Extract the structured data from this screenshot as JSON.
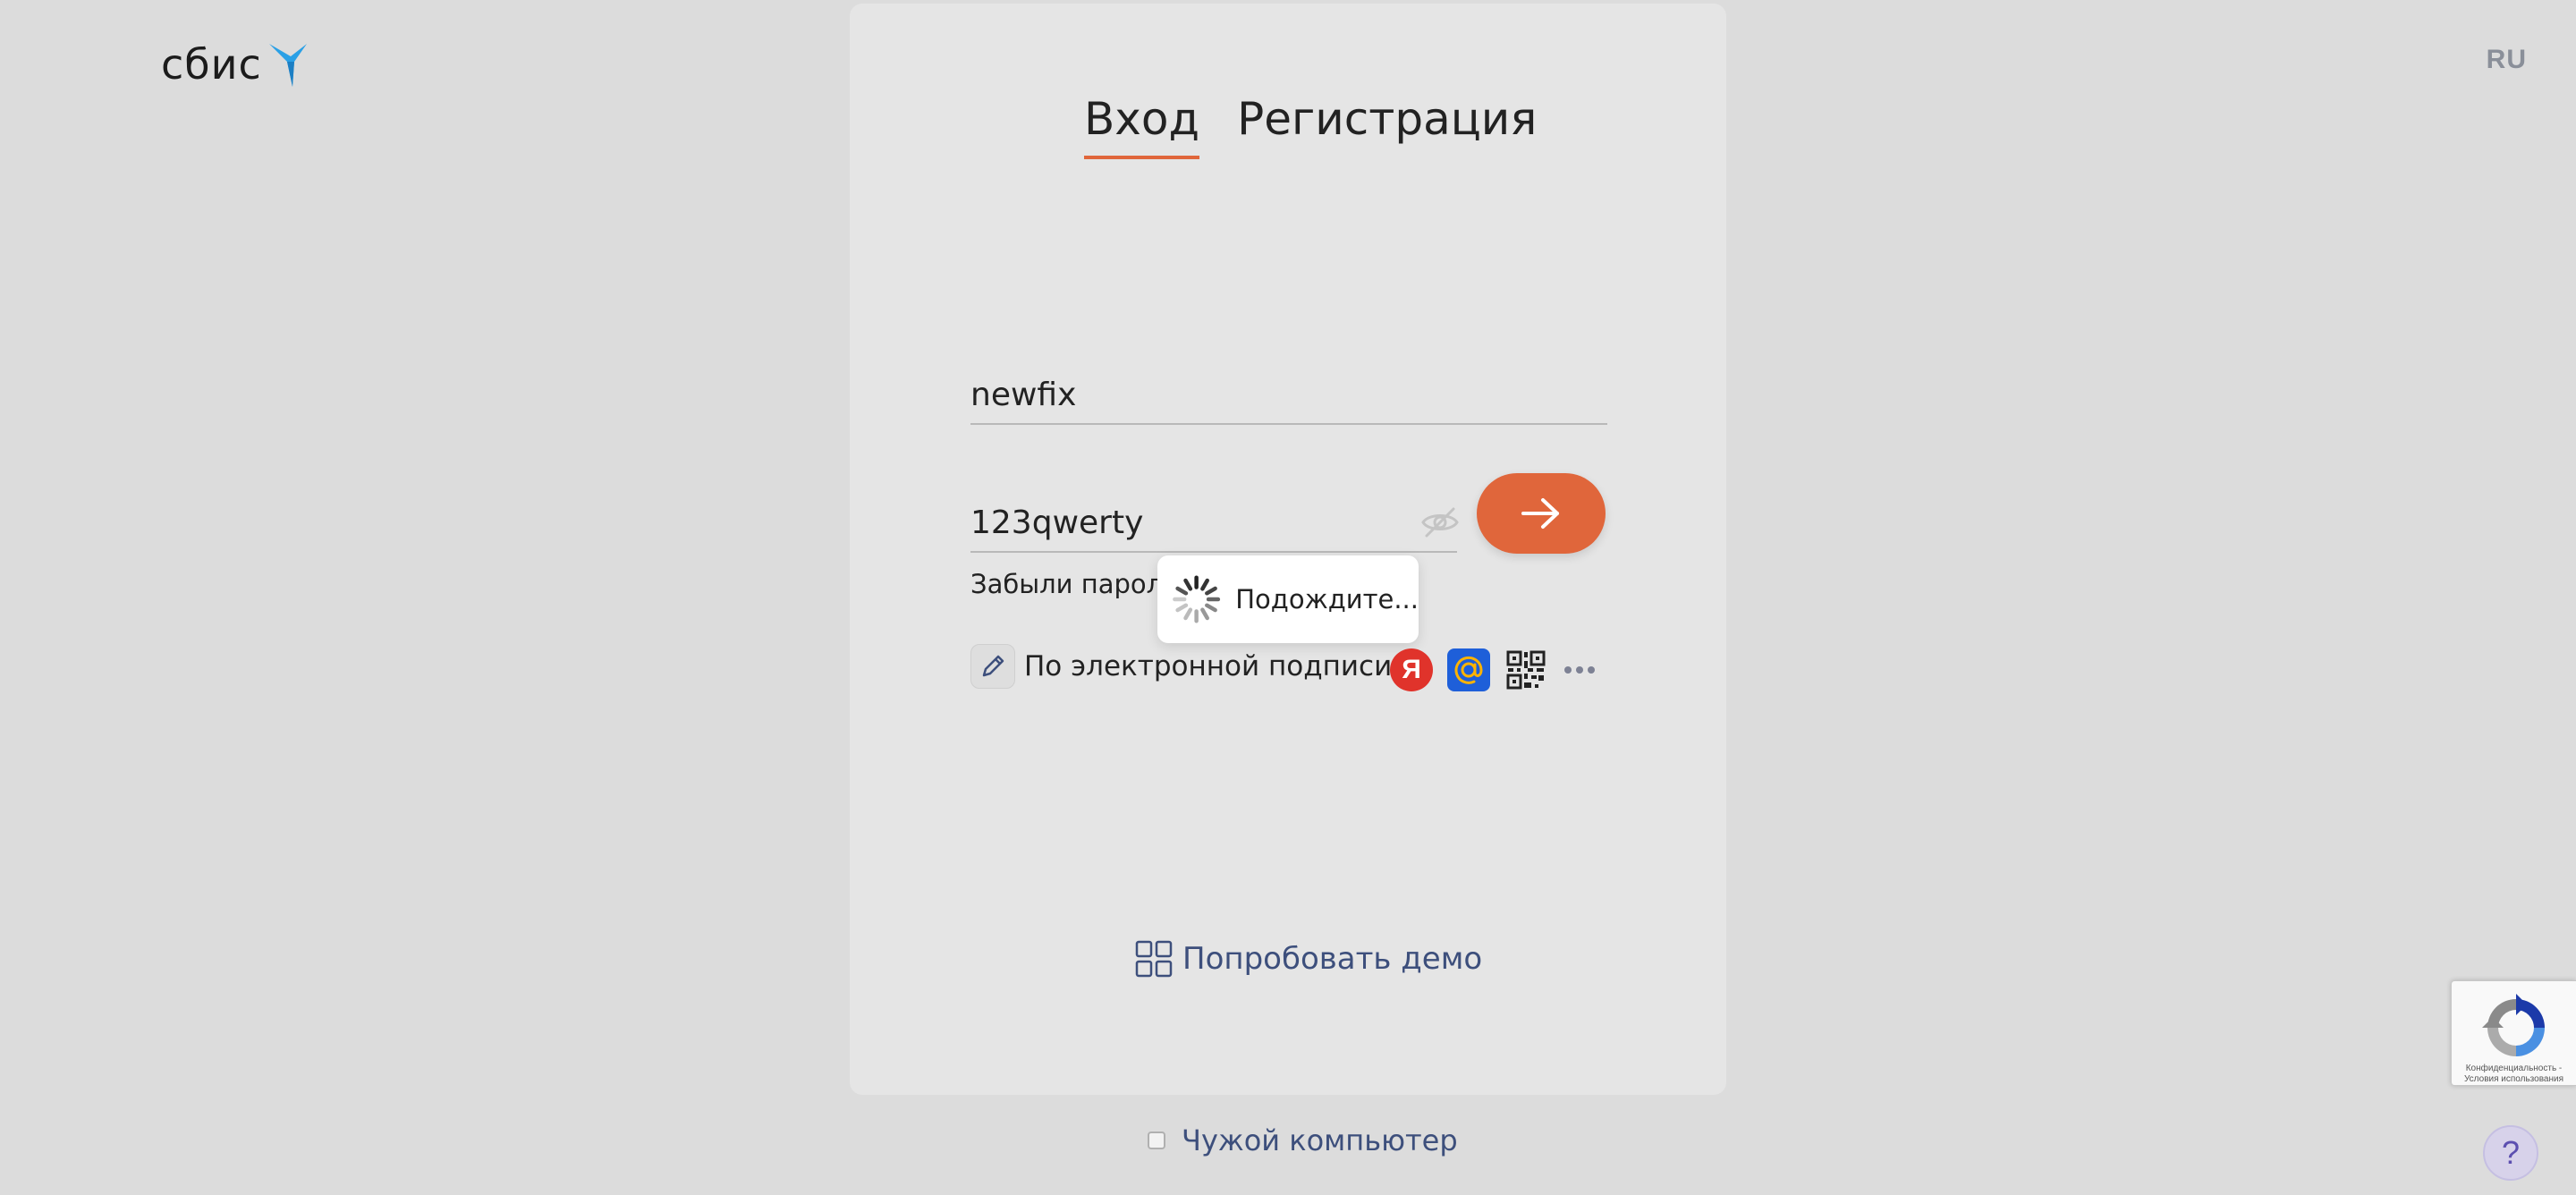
{
  "header": {
    "logo_text": "сбис",
    "language": "RU"
  },
  "tabs": [
    {
      "label": "Вход",
      "active": true
    },
    {
      "label": "Регистрация",
      "active": false
    }
  ],
  "login_form": {
    "login_value": "newfix",
    "password_value": "123qwerty",
    "forgot_password": "Забыли пароль?",
    "submit_icon": "arrow-right-icon",
    "password_toggle_icon": "eye-crossed-icon"
  },
  "loading_popup": {
    "text": "Подождите..."
  },
  "alt_login": {
    "signature_label": "По электронной подписи",
    "yandex_letter": "Я",
    "icons": [
      "pen-icon",
      "yandex-icon",
      "mail-ru-icon",
      "qr-code-icon",
      "more-dots-icon"
    ]
  },
  "demo": {
    "label": "Попробовать демо"
  },
  "foreign_computer": {
    "label": "Чужой компьютер",
    "checked": false
  },
  "recaptcha": {
    "text_line1": "Конфиденциальность -",
    "text_line2": "Условия использования"
  },
  "help": {
    "label": "?"
  },
  "colors": {
    "accent": "#e0663b",
    "background": "#dcdcdc",
    "card": "#e5e5e5",
    "link": "#3d4f7c"
  }
}
